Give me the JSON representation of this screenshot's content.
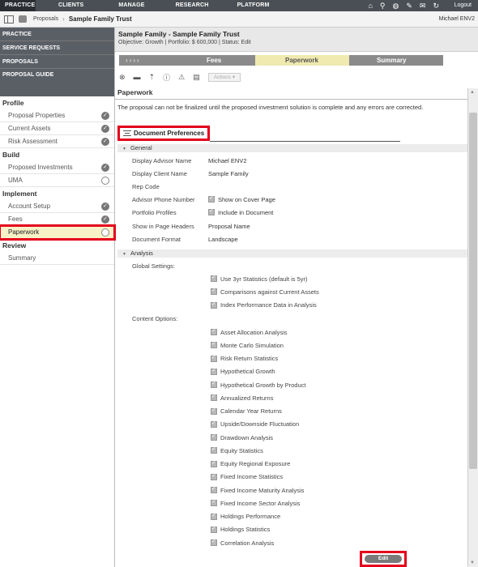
{
  "topnav": {
    "tabs": [
      "PRACTICE",
      "CLIENTS",
      "MANAGE",
      "RESEARCH",
      "PLATFORM"
    ],
    "icons": [
      "home-icon",
      "search-icon",
      "globe-icon",
      "wrench-icon",
      "chat-icon",
      "refresh-icon"
    ],
    "logout": "Logout"
  },
  "breadcrumb": {
    "items": [
      "Proposals",
      "Sample Family Trust"
    ],
    "user": "Michael ENV2"
  },
  "sidebar": {
    "heads": [
      "PRACTICE",
      "SERVICE REQUESTS",
      "PROPOSALS"
    ],
    "guide": "PROPOSAL GUIDE",
    "sections": [
      {
        "title": "Profile",
        "items": [
          {
            "label": "Proposal Properties",
            "status": "done"
          },
          {
            "label": "Current Assets",
            "status": "done"
          },
          {
            "label": "Risk Assessment",
            "status": "done"
          }
        ]
      },
      {
        "title": "Build",
        "items": [
          {
            "label": "Proposed Investments",
            "status": "done"
          },
          {
            "label": "UMA",
            "status": "todo"
          }
        ]
      },
      {
        "title": "Implement",
        "items": [
          {
            "label": "Account Setup",
            "status": "done"
          },
          {
            "label": "Fees",
            "status": "done"
          },
          {
            "label": "Paperwork",
            "status": "todo"
          }
        ]
      },
      {
        "title": "Review",
        "items": [
          {
            "label": "Summary",
            "status": "none"
          }
        ]
      }
    ]
  },
  "header": {
    "title": "Sample Family - Sample Family Trust",
    "objective": "Objective: Growth",
    "portfolio": "Portfolio: $ 600,000",
    "status": "Status: Edit"
  },
  "steps": {
    "fees": "Fees",
    "paperwork": "Paperwork",
    "summary": "Summary"
  },
  "toolbar": {
    "actions": "Actions"
  },
  "page": {
    "title": "Paperwork",
    "notice": "The proposal can not be finalized until the proposed investment solution is complete and any errors are corrected."
  },
  "docprefs": {
    "title": "Document Preferences",
    "general": {
      "title": "General",
      "rows": [
        {
          "k": "Display Advisor Name",
          "v": "Michael ENV2",
          "cb": false
        },
        {
          "k": "Display Client Name",
          "v": "Sample Family",
          "cb": false
        },
        {
          "k": "Rep Code",
          "v": "",
          "cb": false
        },
        {
          "k": "Advisor Phone Number",
          "v": "Show on Cover Page",
          "cb": true
        },
        {
          "k": "Portfolio Profiles",
          "v": "Include in Document",
          "cb": true
        },
        {
          "k": "Show in Page Headers",
          "v": "Proposal Name",
          "cb": false
        },
        {
          "k": "Document Format",
          "v": "Landscape",
          "cb": false
        }
      ]
    },
    "analysis": {
      "title": "Analysis",
      "global_label": "Global Settings:",
      "global": [
        "Use 3yr Statistics (default is 5yr)",
        "Comparisons against Current Assets",
        "Index Performance Data in Analysis"
      ],
      "content_label": "Content Options:",
      "content": [
        "Asset Allocation Analysis",
        "Monte Carlo Simulation",
        "Risk Return Statistics",
        "Hypothetical Growth",
        "Hypothetical Growth by Product",
        "Annualized Returns",
        "Calendar Year Returns",
        "Upside/Downside Fluctuation",
        "Drawdown Analysis",
        "Equity Statistics",
        "Equity Regional Exposure",
        "Fixed Income Statistics",
        "Fixed Income Maturity Analysis",
        "Fixed Income Sector Analysis",
        "Holdings Performance",
        "Holdings Statistics",
        "Correlation Analysis"
      ]
    },
    "edit": "Edit"
  }
}
